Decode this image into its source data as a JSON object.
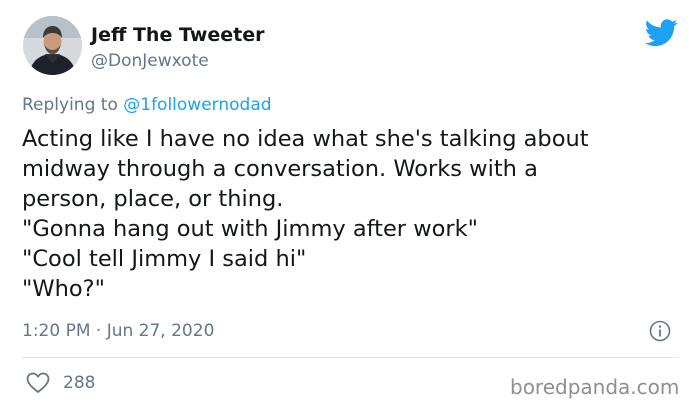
{
  "author": {
    "display_name": "Jeff The Tweeter",
    "handle": "@DonJewxote",
    "avatar_icon": "user-photo-avatar"
  },
  "reply": {
    "prefix": "Replying to ",
    "mention": "@1followernodad"
  },
  "tweet": {
    "lines": [
      "Acting like I have no idea what she's talking about",
      "midway through a conversation.  Works with a",
      "person, place, or thing.",
      "\"Gonna hang out with Jimmy after work\"",
      "\"Cool tell Jimmy I said hi\"",
      "\"Who?\""
    ]
  },
  "meta": {
    "timestamp": "1:20 PM · Jun 27, 2020",
    "info_icon": "info-icon"
  },
  "engagement": {
    "like_icon": "heart-icon",
    "likes": "288"
  },
  "watermark": "boredpanda.com",
  "brand": {
    "logo_icon": "twitter-bird-icon",
    "accent_color": "#1da1f2",
    "text_color": "#14171a",
    "muted_color": "#657786",
    "divider_color": "#e1e8ed"
  }
}
